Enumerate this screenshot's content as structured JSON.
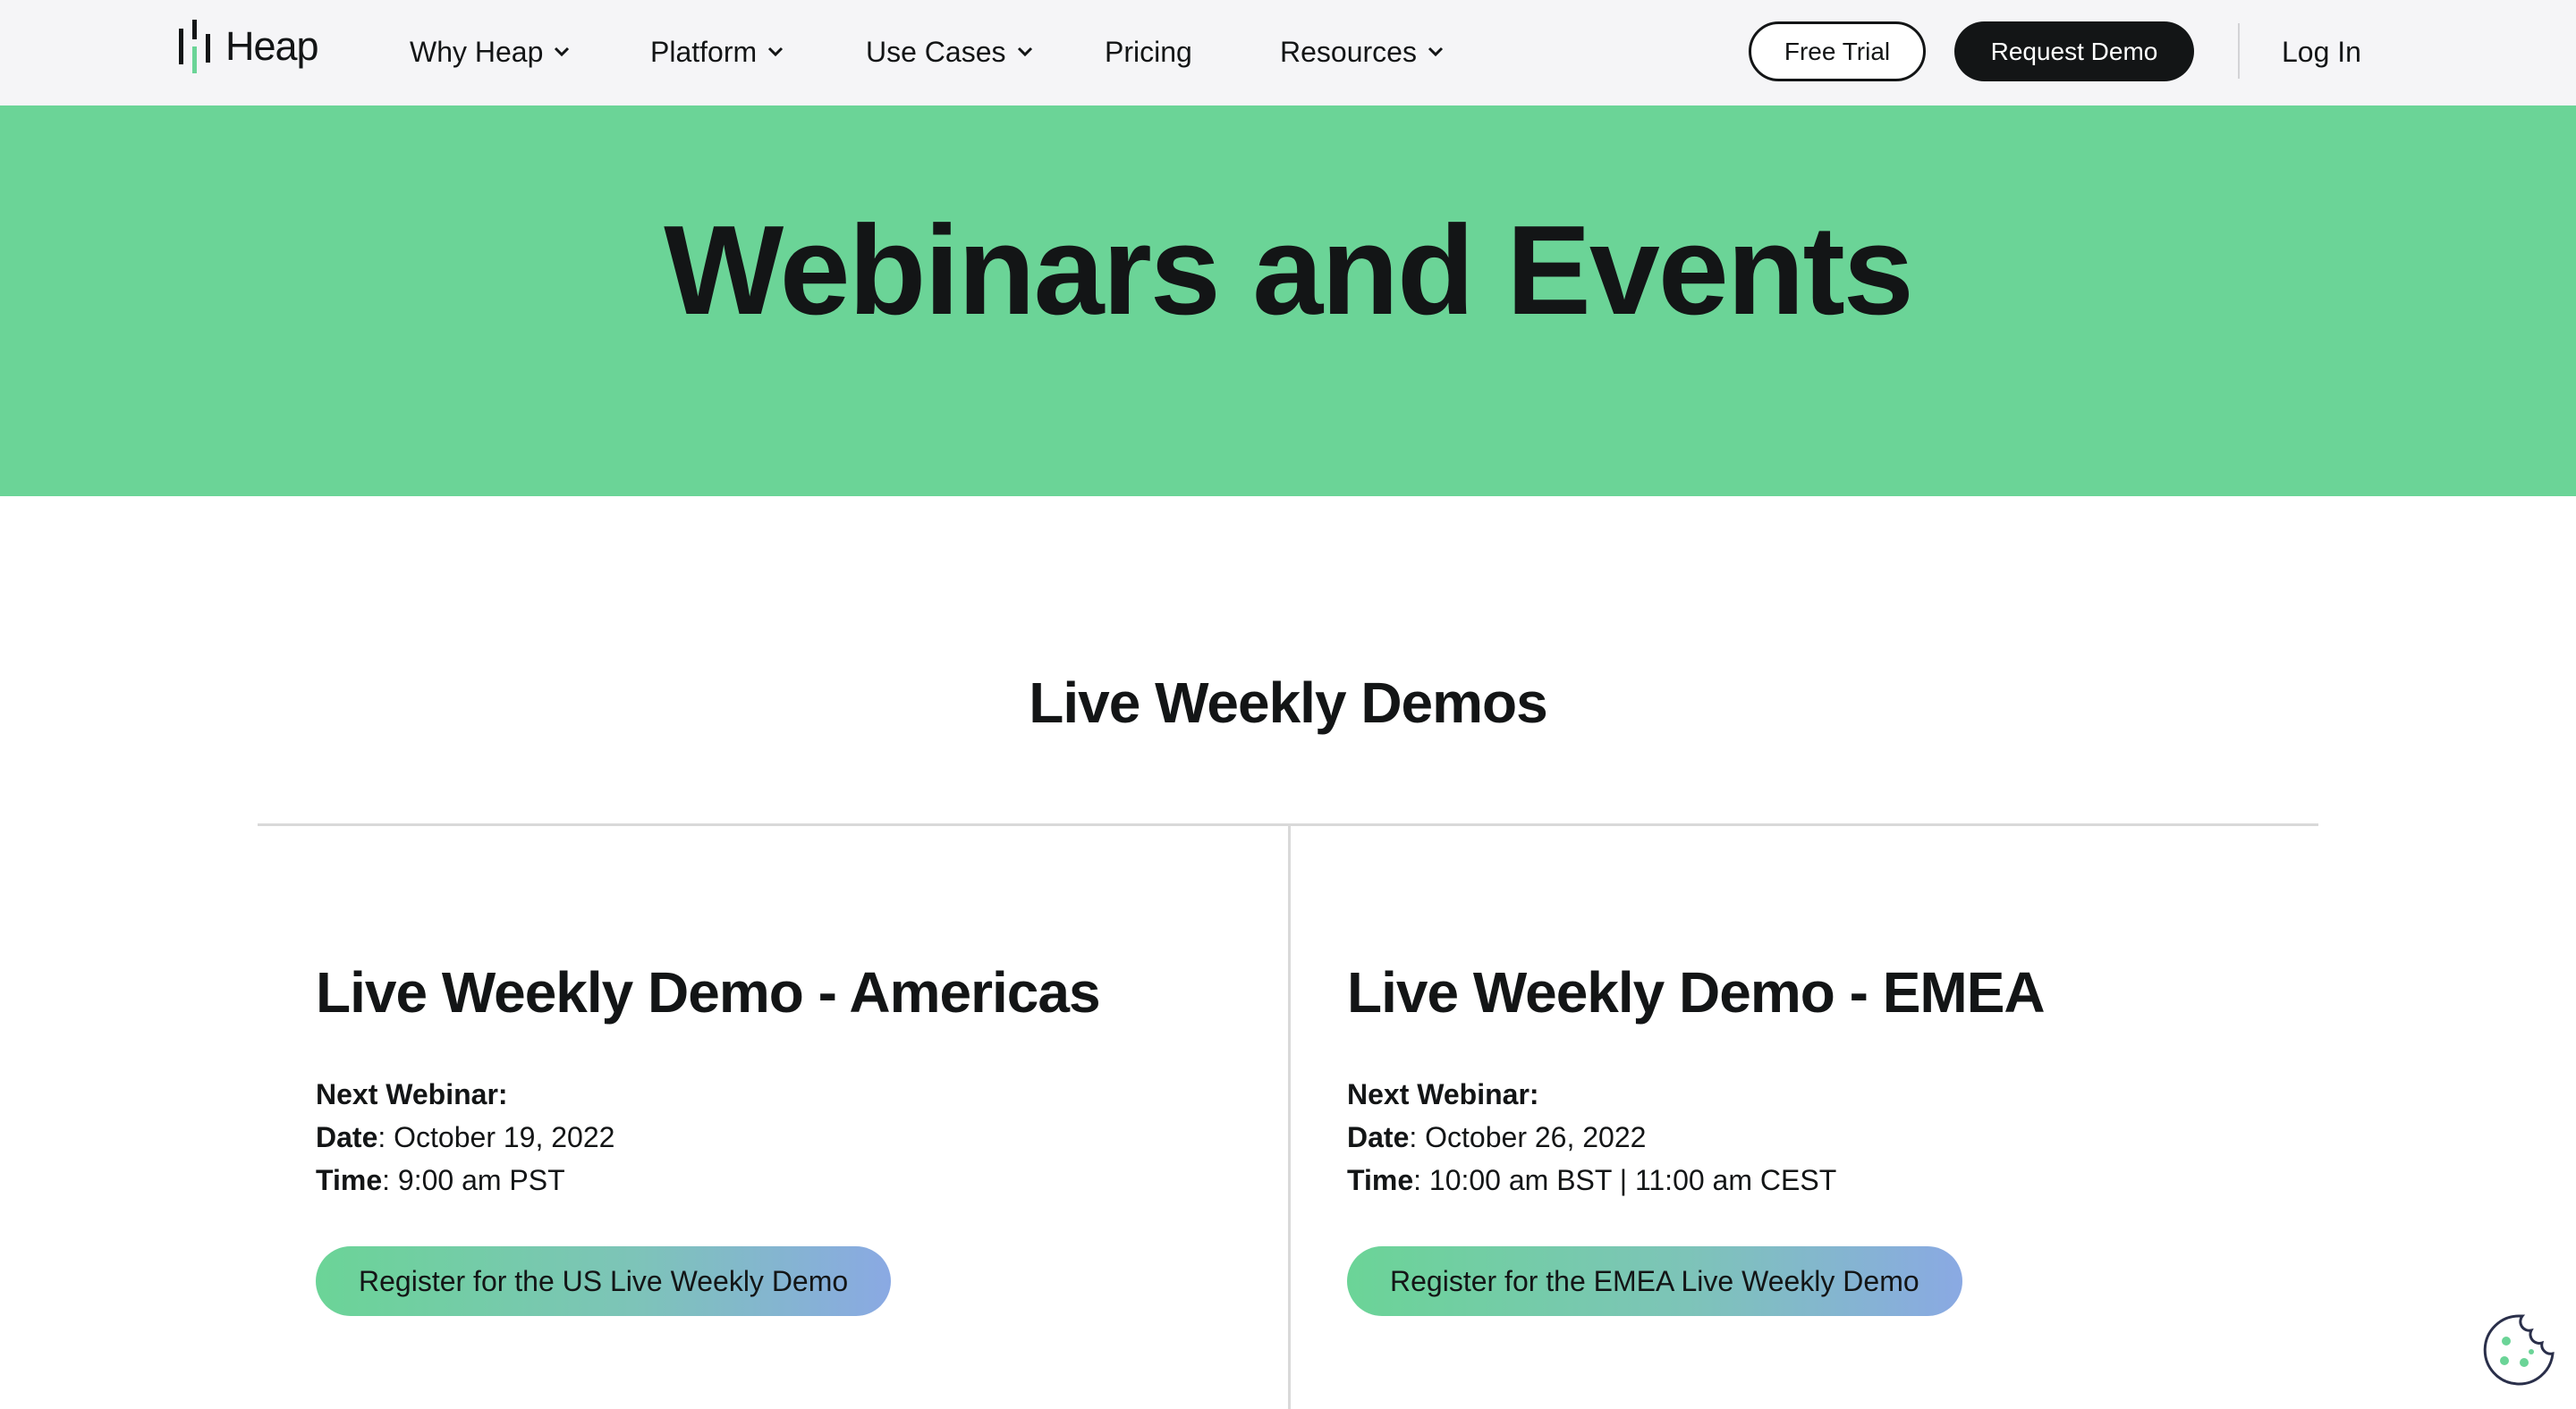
{
  "nav": {
    "logo_text": "Heap",
    "links": [
      {
        "label": "Why Heap",
        "has_dropdown": true
      },
      {
        "label": "Platform",
        "has_dropdown": true
      },
      {
        "label": "Use Cases",
        "has_dropdown": true
      },
      {
        "label": "Pricing",
        "has_dropdown": false
      },
      {
        "label": "Resources",
        "has_dropdown": true
      }
    ],
    "free_trial": "Free Trial",
    "request_demo": "Request Demo",
    "login": "Log In"
  },
  "hero": {
    "title": "Webinars and Events",
    "background": "#6bd497"
  },
  "section": {
    "title": "Live Weekly Demos"
  },
  "cards": [
    {
      "title": "Live Weekly Demo - Americas",
      "next_label": "Next Webinar:",
      "date_label": "Date",
      "date_value": ": October 19, 2022",
      "time_label": "Time",
      "time_value": ": 9:00 am PST",
      "cta": "Register for the US Live Weekly Demo"
    },
    {
      "title": "Live Weekly Demo - EMEA",
      "next_label": "Next Webinar:",
      "date_label": "Date",
      "date_value": ": October 26, 2022",
      "time_label": "Time",
      "time_value": ": 10:00 am BST | 11:00 am CEST",
      "cta": "Register for the EMEA Live Weekly Demo"
    }
  ],
  "colors": {
    "accent_green": "#6bd497",
    "text_dark": "#131516",
    "nav_bg": "#f5f5f7",
    "cta_gradient_end": "#8aa9e3"
  },
  "icons": {
    "logo": "heap-logo-icon",
    "dropdown": "chevron-down-icon",
    "cookie": "cookie-settings-icon"
  }
}
